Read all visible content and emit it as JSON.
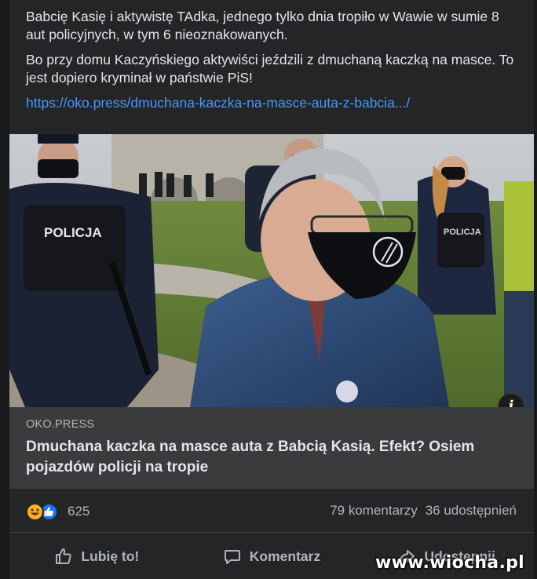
{
  "post": {
    "paragraph1": "Babcię Kasię i aktywistę TAdka, jednego tylko dnia tropiło w Wawie w sumie 8 aut policyjnych, w tym 6 nieoznakowanych.",
    "paragraph2": "Bo przy domu Kaczyńskiego aktywiści jeździli z dmuchaną kaczką na masce. To jest dopiero kryminał w państwie PiS!",
    "link_text": "https://oko.press/dmuchana-kaczka-na-masce-auta-z-babcia.../"
  },
  "preview": {
    "photo_vest_text": "POLICJA",
    "info_icon_glyph": "i",
    "domain": "OKO.PRESS",
    "title": "Dmuchana kaczka na masce auta z Babcią Kasią. Efekt? Osiem pojazdów policji na tropie"
  },
  "stats": {
    "reaction_count": "625",
    "comments": "79 komentarzy",
    "shares": "36 udostępnień"
  },
  "actions": {
    "like": "Lubię to!",
    "comment": "Komentarz",
    "share": "Udostępnij"
  },
  "watermark": "www.wiocha.pl",
  "colors": {
    "background": "#242526",
    "link": "#4599ff",
    "card": "#3a3b3c",
    "muted_text": "#b0b3b8",
    "like_blue": "#1877f2",
    "haha_yellow": "#f7b125"
  }
}
